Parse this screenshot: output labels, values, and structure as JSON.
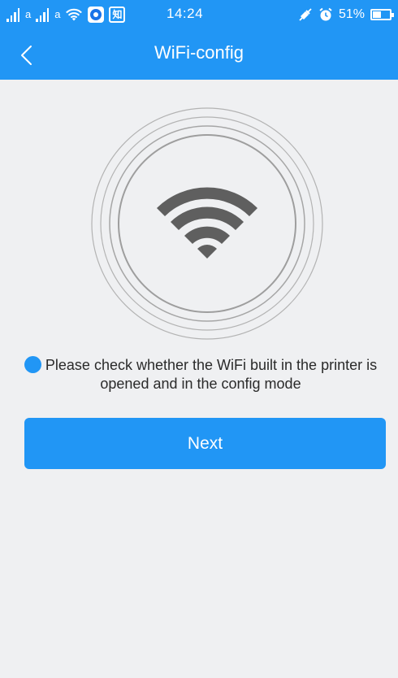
{
  "status_bar": {
    "carrier_mark_1": "a",
    "carrier_mark_2": "a",
    "app_icon_2_text": "知",
    "time": "14:24",
    "battery_percent": "51%",
    "battery_level": 0.51,
    "icons": [
      "signal-icon",
      "signal-icon",
      "wifi-icon",
      "app-notification-icon",
      "zhihu-icon",
      "mute-icon",
      "alarm-icon",
      "battery-icon"
    ]
  },
  "nav": {
    "title": "WiFi-config",
    "back_icon": "chevron-left-icon"
  },
  "illustration": {
    "icon": "wifi-icon",
    "ring_color": "#a9a9a9",
    "wifi_color": "#5f5f5f"
  },
  "message": {
    "bullet_color": "#2196f5",
    "text": "Please check whether the WiFi built in the printer is opened and in the config mode"
  },
  "next_button": {
    "label": "Next"
  },
  "colors": {
    "accent": "#2196f5",
    "background": "#eff0f2"
  }
}
